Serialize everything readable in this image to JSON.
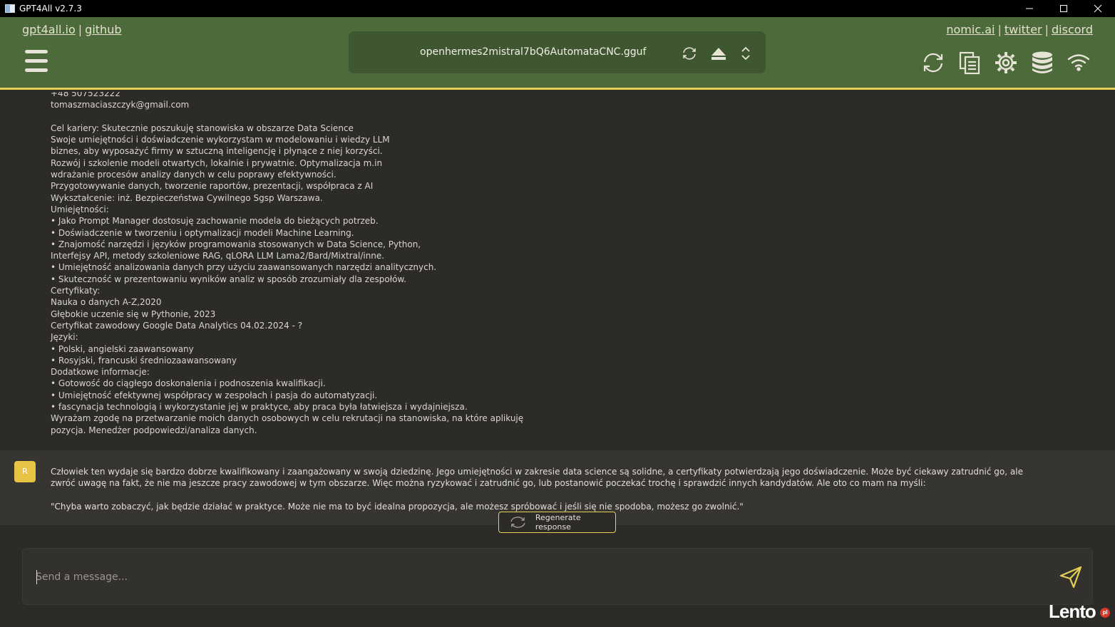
{
  "window": {
    "title": "GPT4All v2.7.3"
  },
  "header": {
    "links_left": [
      "gpt4all.io",
      "github"
    ],
    "links_right": [
      "nomic.ai",
      "twitter",
      "discord"
    ],
    "link_separator": "|",
    "model": {
      "name": "openhermes2mistral7bQ6AutomataCNC.gguf"
    },
    "accent_color": "#e7cf55",
    "background_color": "#4d6a3b"
  },
  "conversation": {
    "prompt_lines": [
      "+48 507523222",
      "tomaszmaciaszczyk@gmail.com",
      "",
      "Cel kariery: Skutecznie poszukuję stanowiska w obszarze Data Science",
      "Swoje umiejętności i doświadczenie wykorzystam w modelowaniu i wiedzy LLM",
      "biznes, aby wyposażyć firmy w sztuczną inteligencję i płynące z niej korzyści.",
      "Rozwój i szkolenie modeli otwartych, lokalnie i prywatnie. Optymalizacja m.in",
      "wdrażanie procesów analizy danych w celu poprawy efektywności.",
      "Przygotowywanie danych, tworzenie raportów, prezentacji, współpraca z AI",
      "Wykształcenie: inż. Bezpieczeństwa Cywilnego Sgsp Warszawa.",
      "Umiejętności:",
      "• Jako Prompt Manager dostosuję zachowanie modela do bieżących potrzeb.",
      "• Doświadczenie w tworzeniu i optymalizacji modeli Machine Learning.",
      "• Znajomość narzędzi i języków programowania stosowanych w Data Science, Python,",
      "Interfejsy API, metody szkoleniowe RAG, qLORA LLM Lama2/Bard/Mixtral/inne.",
      "• Umiejętność analizowania danych przy użyciu zaawansowanych narzędzi analitycznych.",
      "• Skuteczność w prezentowaniu wyników analiz w sposób zrozumiały dla zespołów.",
      "Certyfikaty:",
      "Nauka o danych A-Z,2020",
      "Głębokie uczenie się w Pythonie, 2023",
      "Certyfikat zawodowy Google Data Analytics 04.02.2024 - ?",
      "Języki:",
      "• Polski, angielski zaawansowany",
      "• Rosyjski, francuski średniozaawansowany",
      "Dodatkowe informacje:",
      "• Gotowość do ciągłego doskonalenia i podnoszenia kwalifikacji.",
      "• Umiejętność efektywnej współpracy w zespołach i pasja do automatyzacji.",
      "• fascynacja technologią i wykorzystanie jej w praktyce, aby praca była łatwiejsza i wydajniejsza.",
      "Wyrażam zgodę na przetwarzanie moich danych osobowych w celu rekrutacji na stanowiska, na które aplikuję",
      "pozycja. Menedżer podpowiedzi/analiza danych."
    ],
    "response": {
      "avatar_letter": "R",
      "paragraphs": [
        "Człowiek ten wydaje się bardzo dobrze kwalifikowany i zaangażowany w swoją dziedzinę. Jego umiejętności w zakresie data science są solidne, a certyfikaty potwierdzają jego doświadczenie. Może być ciekawy zatrudnić go, ale zwróć uwagę na fakt, że nie ma jeszcze pracy zawodowej w tym obszarze. Więc można ryzykować i zatrudnić go, lub postanowić poczekać trochę i sprawdzić innych kandydatów. Ale oto co mam na myśli:",
        "",
        "\"Chyba warto zobaczyć, jak będzie działać w praktyce. Może nie ma to być idealna propozycja, ale możesz spróbować i jeśli się nie spodoba, możesz go zwolnić.\""
      ]
    },
    "regenerate_label": "Regenerate response"
  },
  "input": {
    "placeholder": "Send a message..."
  },
  "watermark": {
    "text": "Lento",
    "badge": "pl"
  }
}
